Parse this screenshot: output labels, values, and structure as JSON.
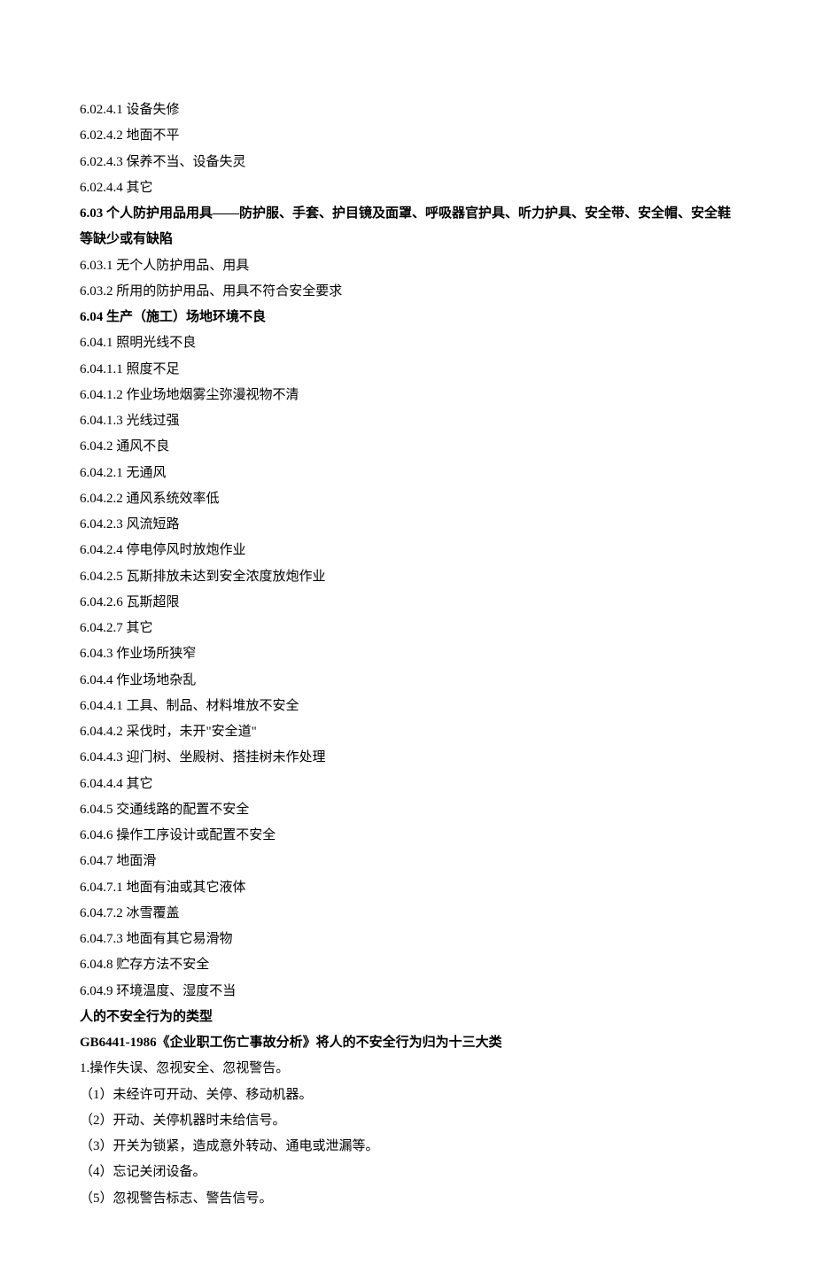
{
  "lines": [
    {
      "text": "6.02.4.1 设备失修",
      "bold": false
    },
    {
      "text": "6.02.4.2 地面不平",
      "bold": false
    },
    {
      "text": "6.02.4.3 保养不当、设备失灵",
      "bold": false
    },
    {
      "text": "6.02.4.4 其它",
      "bold": false
    },
    {
      "text": "6.03 个人防护用品用具——防护服、手套、护目镜及面罩、呼吸器官护具、听力护具、安全带、安全帽、安全鞋等缺少或有缺陷",
      "bold": true
    },
    {
      "text": "6.03.1 无个人防护用品、用具",
      "bold": false
    },
    {
      "text": "6.03.2 所用的防护用品、用具不符合安全要求",
      "bold": false
    },
    {
      "text": "6.04 生产（施工）场地环境不良",
      "bold": true
    },
    {
      "text": "6.04.1 照明光线不良",
      "bold": false
    },
    {
      "text": "6.04.1.1 照度不足",
      "bold": false
    },
    {
      "text": "6.04.1.2 作业场地烟雾尘弥漫视物不清",
      "bold": false
    },
    {
      "text": "6.04.1.3 光线过强",
      "bold": false
    },
    {
      "text": "6.04.2 通风不良",
      "bold": false
    },
    {
      "text": "6.04.2.1 无通风",
      "bold": false
    },
    {
      "text": "6.04.2.2 通风系统效率低",
      "bold": false
    },
    {
      "text": "6.04.2.3 风流短路",
      "bold": false
    },
    {
      "text": "6.04.2.4 停电停风时放炮作业",
      "bold": false
    },
    {
      "text": "6.04.2.5 瓦斯排放未达到安全浓度放炮作业",
      "bold": false
    },
    {
      "text": "6.04.2.6 瓦斯超限",
      "bold": false
    },
    {
      "text": "6.04.2.7 其它",
      "bold": false
    },
    {
      "text": "6.04.3 作业场所狭窄",
      "bold": false
    },
    {
      "text": "6.04.4 作业场地杂乱",
      "bold": false
    },
    {
      "text": "6.04.4.1 工具、制品、材料堆放不安全",
      "bold": false
    },
    {
      "text": "6.04.4.2 采伐时，未开\"安全道\"",
      "bold": false
    },
    {
      "text": "6.04.4.3 迎门树、坐殿树、搭挂树未作处理",
      "bold": false
    },
    {
      "text": "6.04.4.4 其它",
      "bold": false
    },
    {
      "text": "6.04.5 交通线路的配置不安全",
      "bold": false
    },
    {
      "text": "6.04.6 操作工序设计或配置不安全",
      "bold": false
    },
    {
      "text": "6.04.7 地面滑",
      "bold": false
    },
    {
      "text": "6.04.7.1 地面有油或其它液体",
      "bold": false
    },
    {
      "text": "6.04.7.2 冰雪覆盖",
      "bold": false
    },
    {
      "text": "6.04.7.3 地面有其它易滑物",
      "bold": false
    },
    {
      "text": "6.04.8 贮存方法不安全",
      "bold": false
    },
    {
      "text": "6.04.9 环境温度、湿度不当",
      "bold": false
    },
    {
      "text": "人的不安全行为的类型",
      "bold": true
    },
    {
      "text": "GB6441-1986《企业职工伤亡事故分析》将人的不安全行为归为十三大类",
      "bold": true
    },
    {
      "text": "1.操作失误、忽视安全、忽视警告。",
      "bold": false
    },
    {
      "text": "（1）未经许可开动、关停、移动机器。",
      "bold": false
    },
    {
      "text": "（2）开动、关停机器时未给信号。",
      "bold": false
    },
    {
      "text": "（3）开关为锁紧，造成意外转动、通电或泄漏等。",
      "bold": false
    },
    {
      "text": "（4）忘记关闭设备。",
      "bold": false
    },
    {
      "text": "（5）忽视警告标志、警告信号。",
      "bold": false
    }
  ]
}
